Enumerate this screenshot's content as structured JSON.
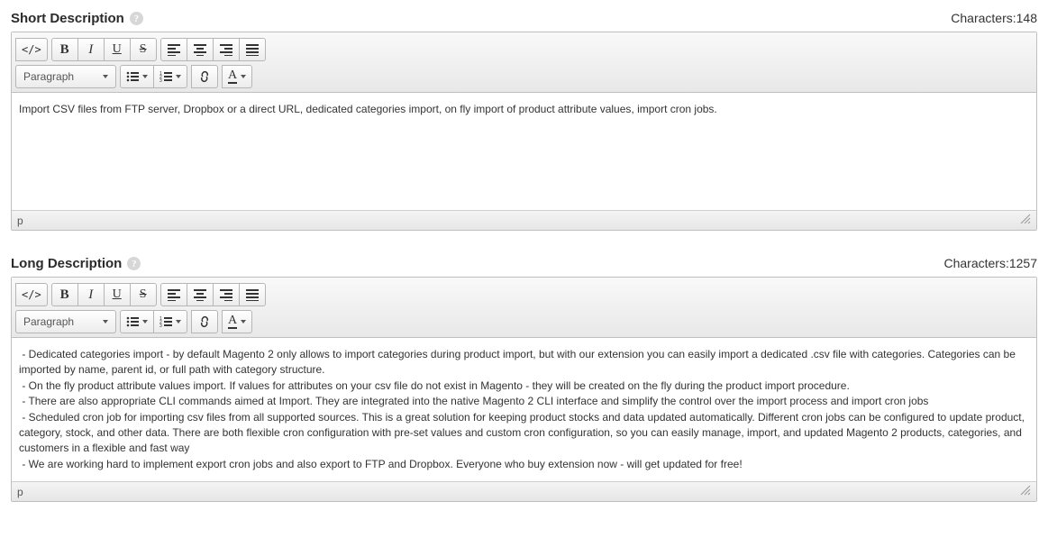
{
  "short": {
    "label": "Short Description",
    "char_label": "Characters:",
    "char_count": "148",
    "format_label": "Paragraph",
    "content": "Import CSV files from FTP server, Dropbox or a direct URL, dedicated categories import, on fly import of product attribute values, import cron jobs.",
    "path": "p"
  },
  "long": {
    "label": "Long Description",
    "char_label": "Characters:",
    "char_count": "1257",
    "format_label": "Paragraph",
    "content": " - Dedicated categories import - by default Magento 2 only allows to import categories during product import, but with our extension you can easily import a dedicated .csv file with categories. Categories can be imported by name, parent id, or full path with category structure.\n - On the fly product attribute values import. If values for attributes on your csv file do not exist in Magento - they will be created on the fly during the product import procedure.\n - There are also appropriate CLI commands aimed at Import. They are integrated into the native Magento 2 CLI interface and simplify the control over the import process and import cron jobs\n - Scheduled cron job for importing csv files from all supported sources. This is a great solution for keeping product stocks and data updated automatically. Different cron jobs can be configured to update product, category, stock, and other data. There are both flexible cron configuration with pre-set values and custom cron configuration, so you can easily manage, import, and updated Magento 2 products, categories, and customers in a flexible and fast way\n - We are working hard to implement export cron jobs and also export to FTP and Dropbox. Everyone who buy extension now - will get updated for free!",
    "path": "p"
  },
  "icons": {
    "text_color_letter": "A"
  }
}
